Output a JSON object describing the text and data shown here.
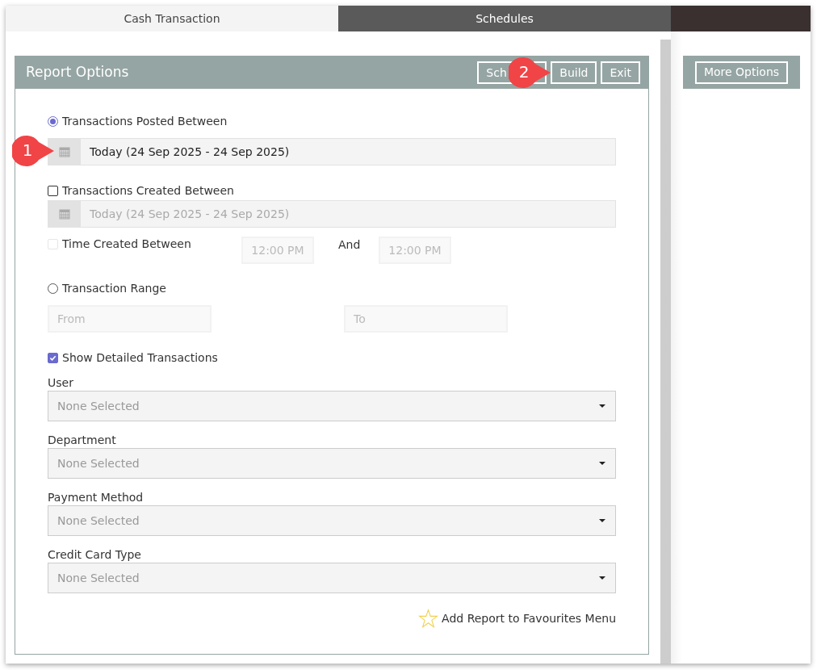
{
  "tabs": [
    {
      "label": "Cash Transaction",
      "selected": true
    },
    {
      "label": "Schedules",
      "selected": false
    }
  ],
  "panel": {
    "title": "Report Options",
    "buttons": [
      {
        "label": "Sch"
      },
      {
        "label": "Build"
      },
      {
        "label": "Exit"
      }
    ]
  },
  "posted": {
    "label": "Transactions Posted Between",
    "selected": true,
    "value": "Today (24 Sep 2025 - 24 Sep 2025)"
  },
  "created": {
    "label": "Transactions Created Between",
    "checked": false,
    "value": "Today (24 Sep 2025 - 24 Sep 2025)"
  },
  "time": {
    "label": "Time Created Between",
    "checked": false,
    "disabled": true,
    "from": "12:00 PM",
    "and": "And",
    "to": "12:00 PM"
  },
  "range": {
    "label": "Transaction Range",
    "selected": false,
    "from_placeholder": "From",
    "to_placeholder": "To"
  },
  "detailed": {
    "label": "Show Detailed Transactions",
    "checked": true
  },
  "selects": [
    {
      "label": "User",
      "value": "None Selected"
    },
    {
      "label": "Department",
      "value": "None Selected"
    },
    {
      "label": "Payment Method",
      "value": "None Selected"
    },
    {
      "label": "Credit Card Type",
      "value": "None Selected"
    }
  ],
  "favourites": "Add Report to Favourites Menu",
  "more_options": "More Options",
  "callouts": [
    {
      "number": "1"
    },
    {
      "number": "2"
    }
  ]
}
